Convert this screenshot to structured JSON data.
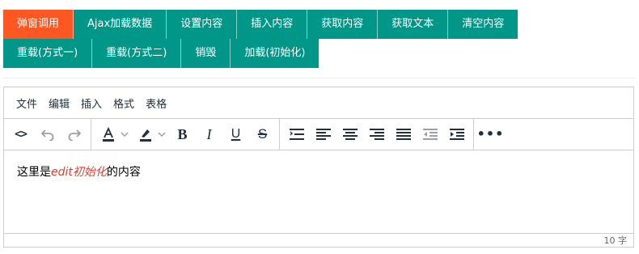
{
  "buttons_row1": [
    {
      "label": "弹窗调用"
    },
    {
      "label": "Ajax加载数据"
    },
    {
      "label": "设置内容"
    },
    {
      "label": "插入内容"
    },
    {
      "label": "获取内容"
    },
    {
      "label": "获取文本"
    },
    {
      "label": "清空内容"
    }
  ],
  "buttons_row2": [
    {
      "label": "重载(方式一)"
    },
    {
      "label": "重载(方式二)"
    },
    {
      "label": "销毁"
    },
    {
      "label": "加载(初始化)"
    }
  ],
  "colors": {
    "primary_button": "#ff5722",
    "default_button": "#009688",
    "emphasis_text": "#e03e2d"
  },
  "editor": {
    "menu": [
      "文件",
      "编辑",
      "插入",
      "格式",
      "表格"
    ],
    "toolbar_icons": [
      "code-icon",
      "undo-icon",
      "redo-icon",
      "text-color-icon",
      "highlight-color-icon",
      "bold-icon",
      "italic-icon",
      "underline-icon",
      "strikethrough-icon",
      "line-height-icon",
      "align-left-icon",
      "align-center-icon",
      "align-right-icon",
      "align-justify-icon",
      "outdent-icon",
      "indent-icon",
      "more-icon"
    ],
    "content": {
      "before": "这里是",
      "emphasis": "edit初始化",
      "after": "的内容"
    },
    "word_count": "10 字"
  }
}
